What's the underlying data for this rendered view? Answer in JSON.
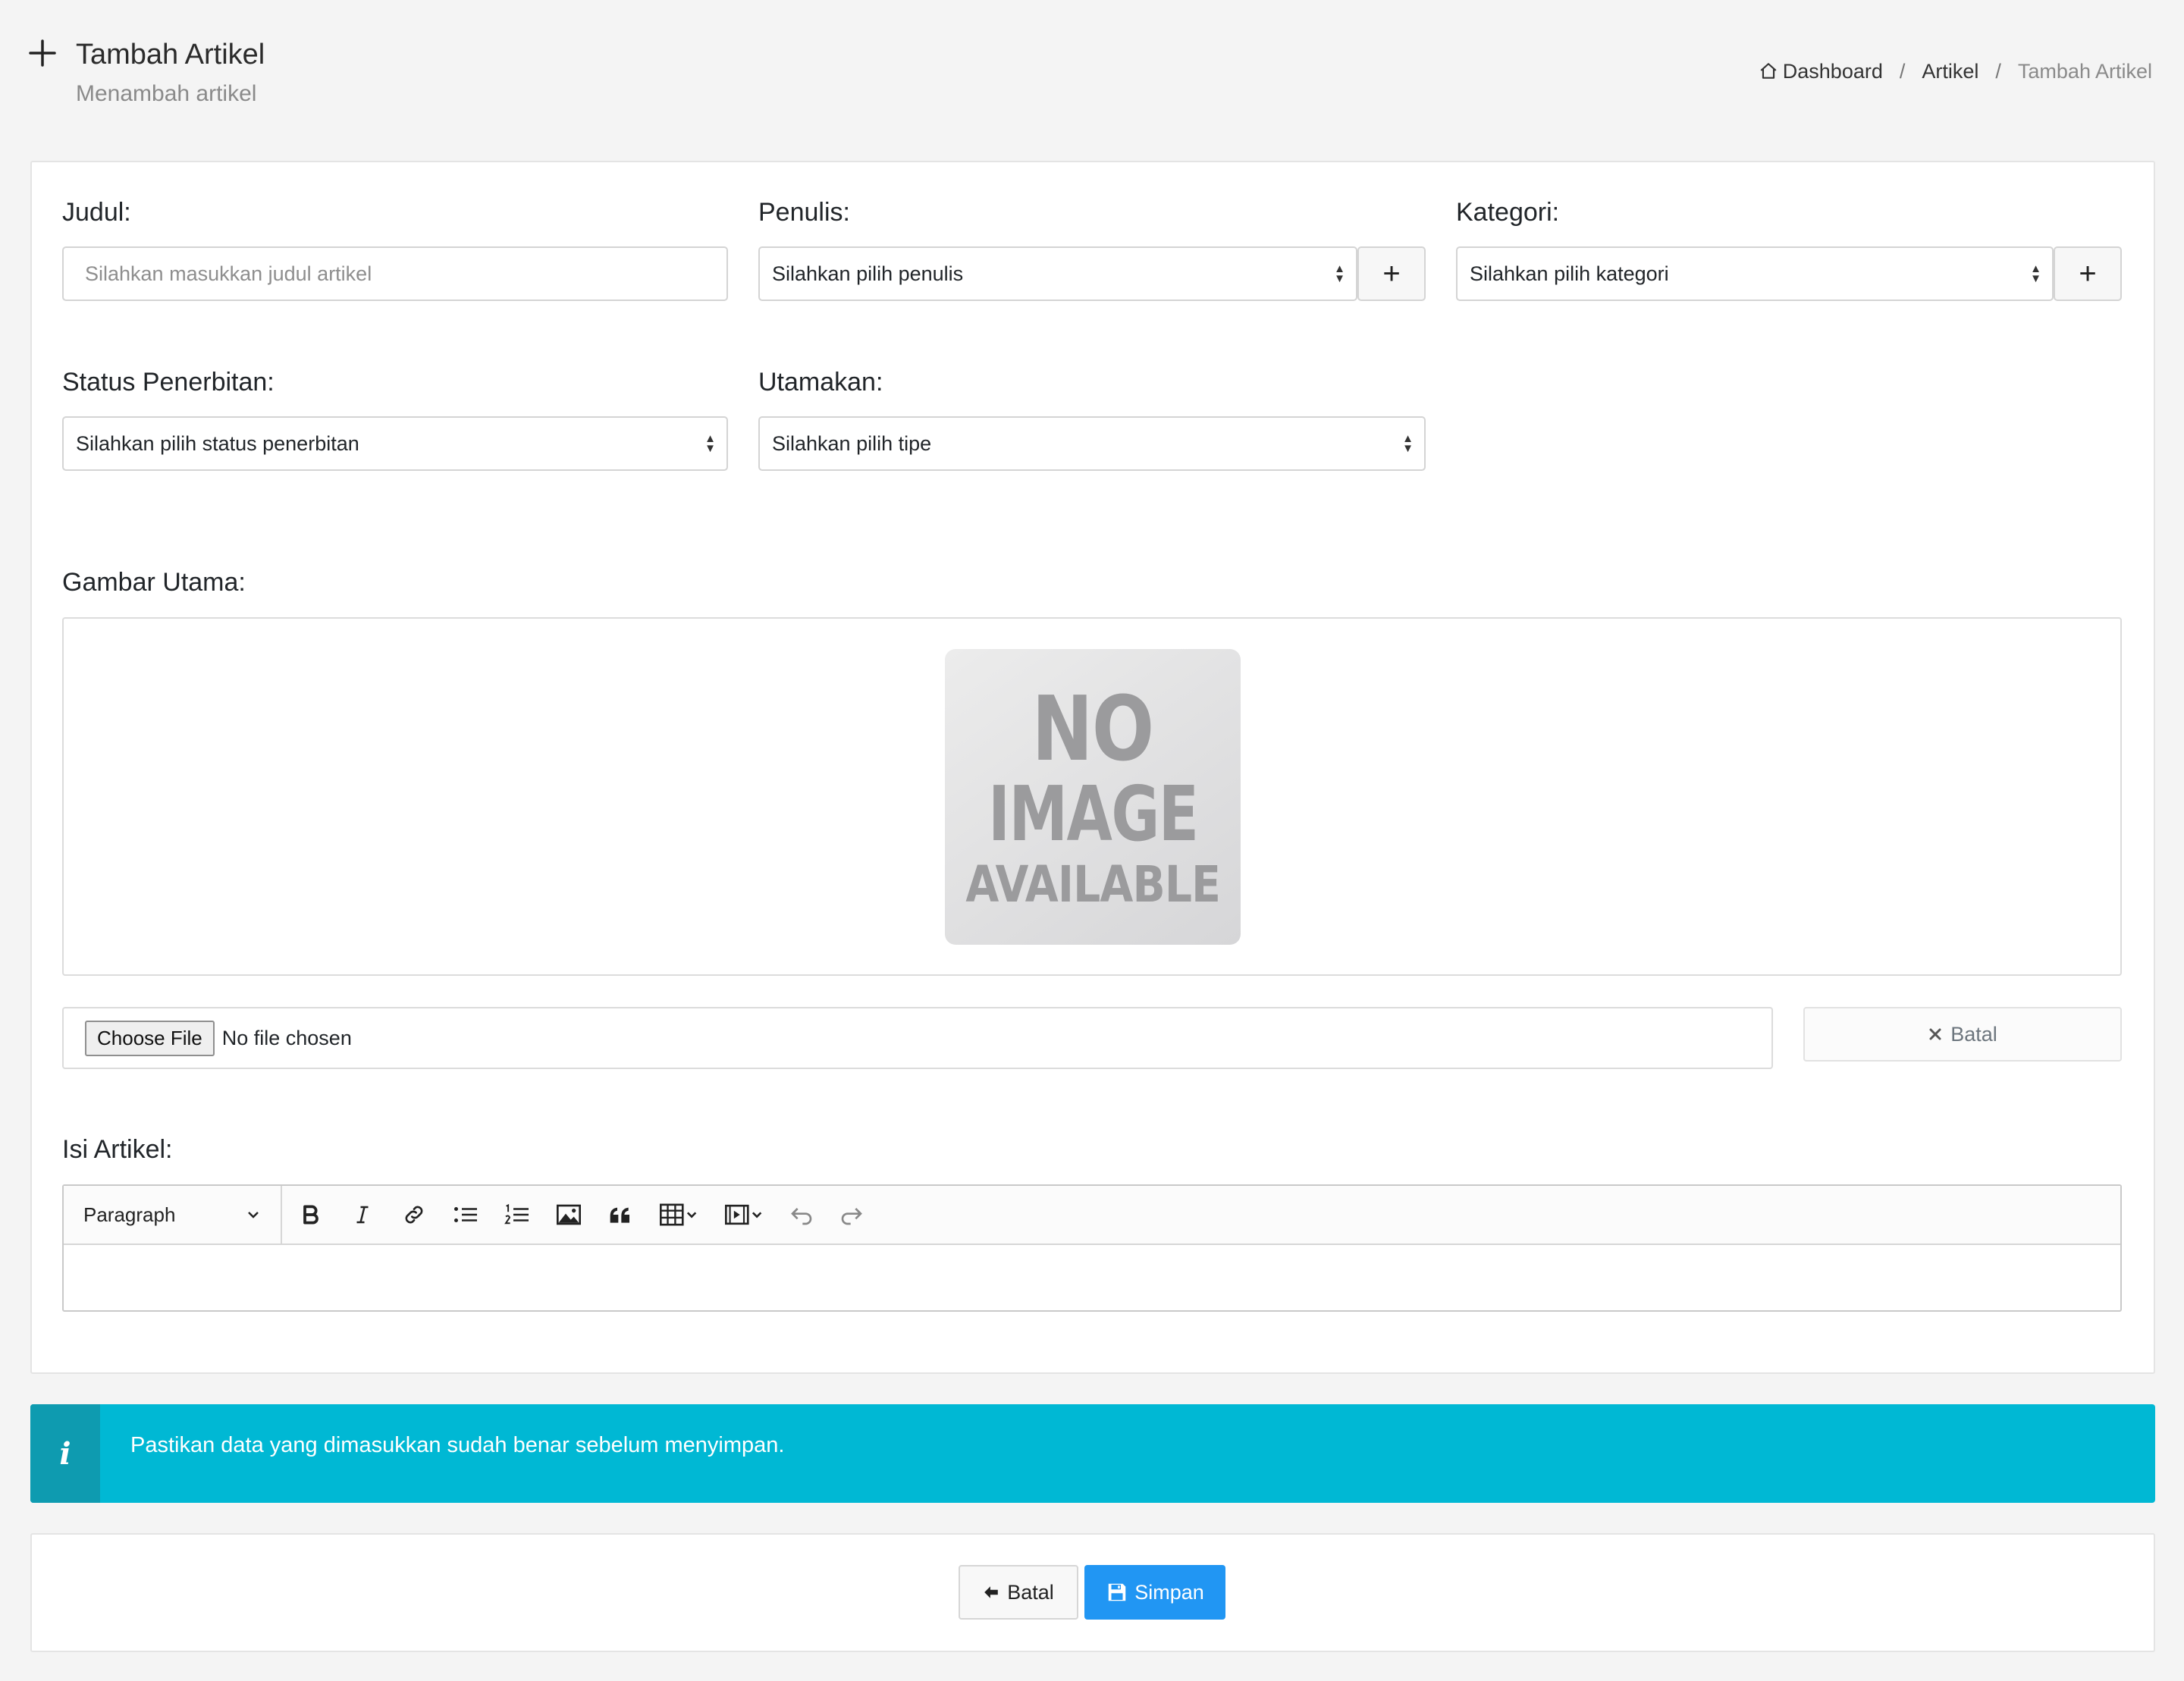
{
  "header": {
    "title": "Tambah Artikel",
    "subtitle": "Menambah artikel"
  },
  "breadcrumb": {
    "home": "Dashboard",
    "sep": "/",
    "parent": "Artikel",
    "current": "Tambah Artikel"
  },
  "form": {
    "judul": {
      "label": "Judul:",
      "placeholder": "Silahkan masukkan judul artikel",
      "value": ""
    },
    "penulis": {
      "label": "Penulis:",
      "selected": "Silahkan pilih penulis",
      "add": "+"
    },
    "kategori": {
      "label": "Kategori:",
      "selected": "Silahkan pilih kategori",
      "add": "+"
    },
    "status": {
      "label": "Status Penerbitan:",
      "selected": "Silahkan pilih status penerbitan"
    },
    "utamakan": {
      "label": "Utamakan:",
      "selected": "Silahkan pilih tipe"
    },
    "gambar": {
      "label": "Gambar Utama:",
      "placeholder_lines": [
        "NO",
        "IMAGE",
        "AVAILABLE"
      ],
      "choose_label": "Choose File",
      "file_status": "No file chosen",
      "cancel_label": "Batal"
    },
    "isi": {
      "label": "Isi Artikel:",
      "heading_select": "Paragraph",
      "toolbar_icons": [
        "bold-icon",
        "italic-icon",
        "link-icon",
        "bulleted-list-icon",
        "numbered-list-icon",
        "image-icon",
        "blockquote-icon",
        "table-icon",
        "media-icon",
        "undo-icon",
        "redo-icon"
      ]
    }
  },
  "alert": {
    "icon": "i",
    "message": "Pastikan data yang dimasukkan sudah benar sebelum menyimpan.",
    "color": "#00b8d4"
  },
  "actions": {
    "cancel_label": "Batal",
    "save_label": "Simpan",
    "save_color": "#2196f3"
  }
}
